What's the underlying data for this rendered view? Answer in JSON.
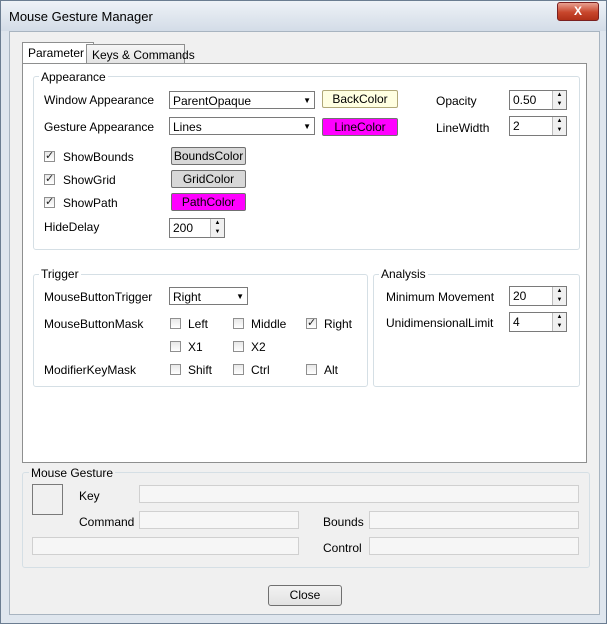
{
  "window": {
    "title": "Mouse Gesture Manager",
    "close_glyph": "X"
  },
  "tabs": [
    {
      "label": "Parameter"
    },
    {
      "label": "Keys & Commands"
    }
  ],
  "appearance": {
    "legend": "Appearance",
    "window_label": "Window Appearance",
    "window_value": "ParentOpaque",
    "gesture_label": "Gesture Appearance",
    "gesture_value": "Lines",
    "back_color": "BackColor",
    "line_color": "LineColor",
    "opacity_label": "Opacity",
    "opacity_value": "0.50",
    "linewidth_label": "LineWidth",
    "linewidth_value": "2",
    "show_bounds": "ShowBounds",
    "show_grid": "ShowGrid",
    "show_path": "ShowPath",
    "bounds_color": "BoundsColor",
    "grid_color": "GridColor",
    "path_color": "PathColor",
    "hide_delay_label": "HideDelay",
    "hide_delay_value": "200"
  },
  "trigger": {
    "legend": "Trigger",
    "mouse_button_trigger_label": "MouseButtonTrigger",
    "mouse_button_trigger_value": "Right",
    "mouse_button_mask_label": "MouseButtonMask",
    "left": "Left",
    "middle": "Middle",
    "right": "Right",
    "x1": "X1",
    "x2": "X2",
    "modifier_key_mask_label": "ModifierKeyMask",
    "shift": "Shift",
    "ctrl": "Ctrl",
    "alt": "Alt"
  },
  "analysis": {
    "legend": "Analysis",
    "min_movement_label": "Minimum Movement",
    "min_movement_value": "20",
    "unidim_label": "UnidimensionalLimit",
    "unidim_value": "4"
  },
  "mouse_gesture": {
    "legend": "Mouse Gesture",
    "key_label": "Key",
    "command_label": "Command",
    "bounds_label": "Bounds",
    "control_label": "Control"
  },
  "footer": {
    "close_label": "Close"
  },
  "colors": {
    "back_color_swatch": "#ffffe1",
    "magenta": "#ff00ff",
    "button_gray": "#d8d8d8"
  },
  "glyphs": {
    "check": "✓",
    "dropdown": "▼",
    "spin_up": "▲",
    "spin_down": "▼"
  }
}
